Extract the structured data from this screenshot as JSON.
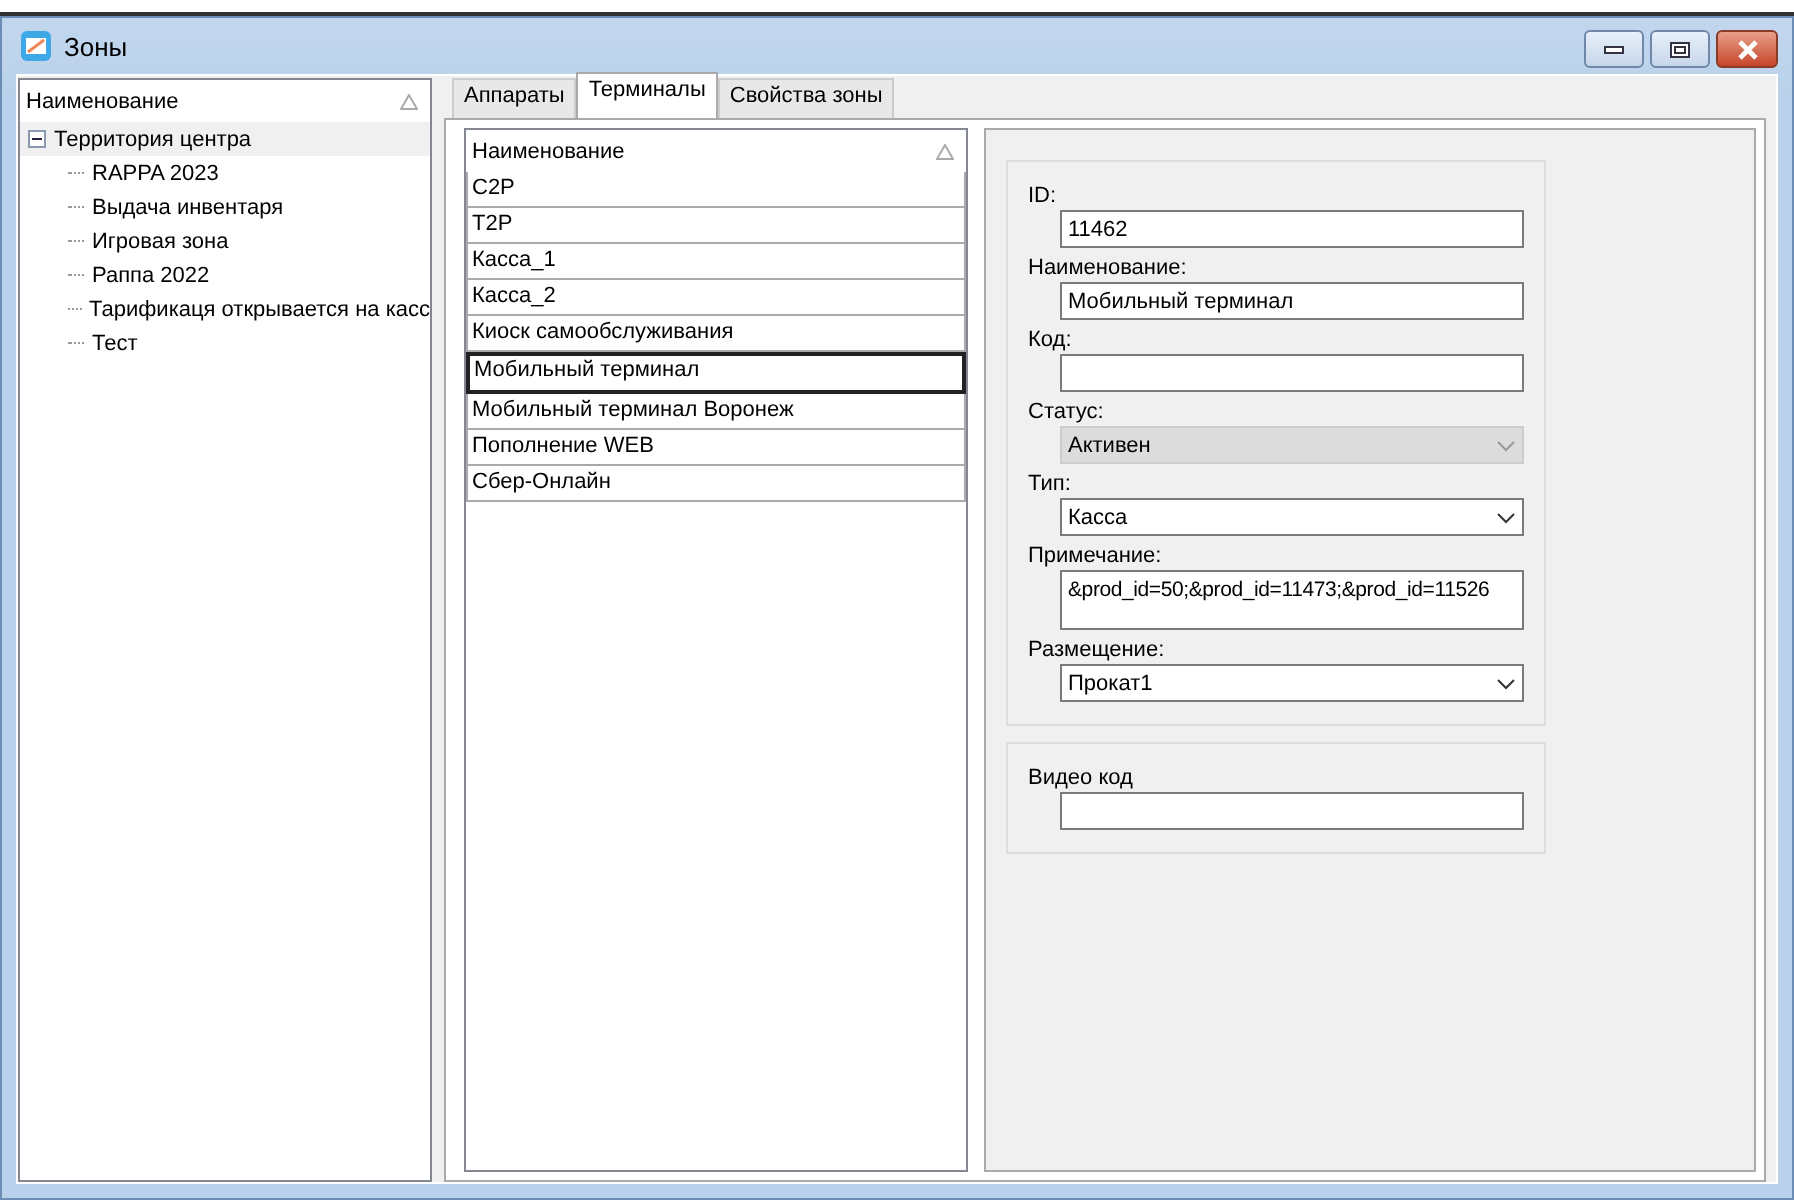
{
  "window": {
    "title": "Зоны"
  },
  "tree": {
    "header": "Наименование",
    "root": {
      "label": "Территория центра",
      "expanded": true,
      "selected": true,
      "children": [
        {
          "label": "RAPPA 2023"
        },
        {
          "label": "Выдача инвентаря"
        },
        {
          "label": "Игровая зона"
        },
        {
          "label": "Раппа 2022"
        },
        {
          "label": "Тарификаця открывается на касс"
        },
        {
          "label": "Тест"
        }
      ]
    }
  },
  "tabs": [
    {
      "label": "Аппараты",
      "selected": false
    },
    {
      "label": "Терминалы",
      "selected": true
    },
    {
      "label": "Свойства зоны",
      "selected": false
    }
  ],
  "list": {
    "header": "Наименование",
    "rows": [
      {
        "label": "C2P",
        "selected": false
      },
      {
        "label": "T2P",
        "selected": false
      },
      {
        "label": "Касса_1",
        "selected": false
      },
      {
        "label": "Касса_2",
        "selected": false
      },
      {
        "label": "Киоск самообслуживания",
        "selected": false
      },
      {
        "label": "Мобильный терминал",
        "selected": true
      },
      {
        "label": "Мобильный терминал Воронеж",
        "selected": false
      },
      {
        "label": "Пополнение WEB",
        "selected": false
      },
      {
        "label": "Сбер-Онлайн",
        "selected": false
      }
    ]
  },
  "form": {
    "groups": [
      {
        "fields": [
          {
            "kind": "text",
            "label": "ID:",
            "value": "11462",
            "disabled": false
          },
          {
            "kind": "text",
            "label": "Наименование:",
            "value": "Мобильный терминал",
            "disabled": false
          },
          {
            "kind": "text",
            "label": "Код:",
            "disabled": false
          },
          {
            "kind": "select",
            "label": "Статус:",
            "value": "Активен",
            "disabled": true
          },
          {
            "kind": "select",
            "label": "Тип:",
            "value": "Касса",
            "disabled": false
          },
          {
            "kind": "textarea",
            "label": "Примечание:",
            "value": "&prod_id=50;&prod_id=11473;&prod_id=11526",
            "disabled": false
          },
          {
            "kind": "select",
            "label": "Размещение:",
            "value": "Прокат1",
            "disabled": false
          }
        ]
      },
      {
        "fields": [
          {
            "kind": "text",
            "label": "Видео код",
            "disabled": false
          }
        ]
      }
    ]
  }
}
